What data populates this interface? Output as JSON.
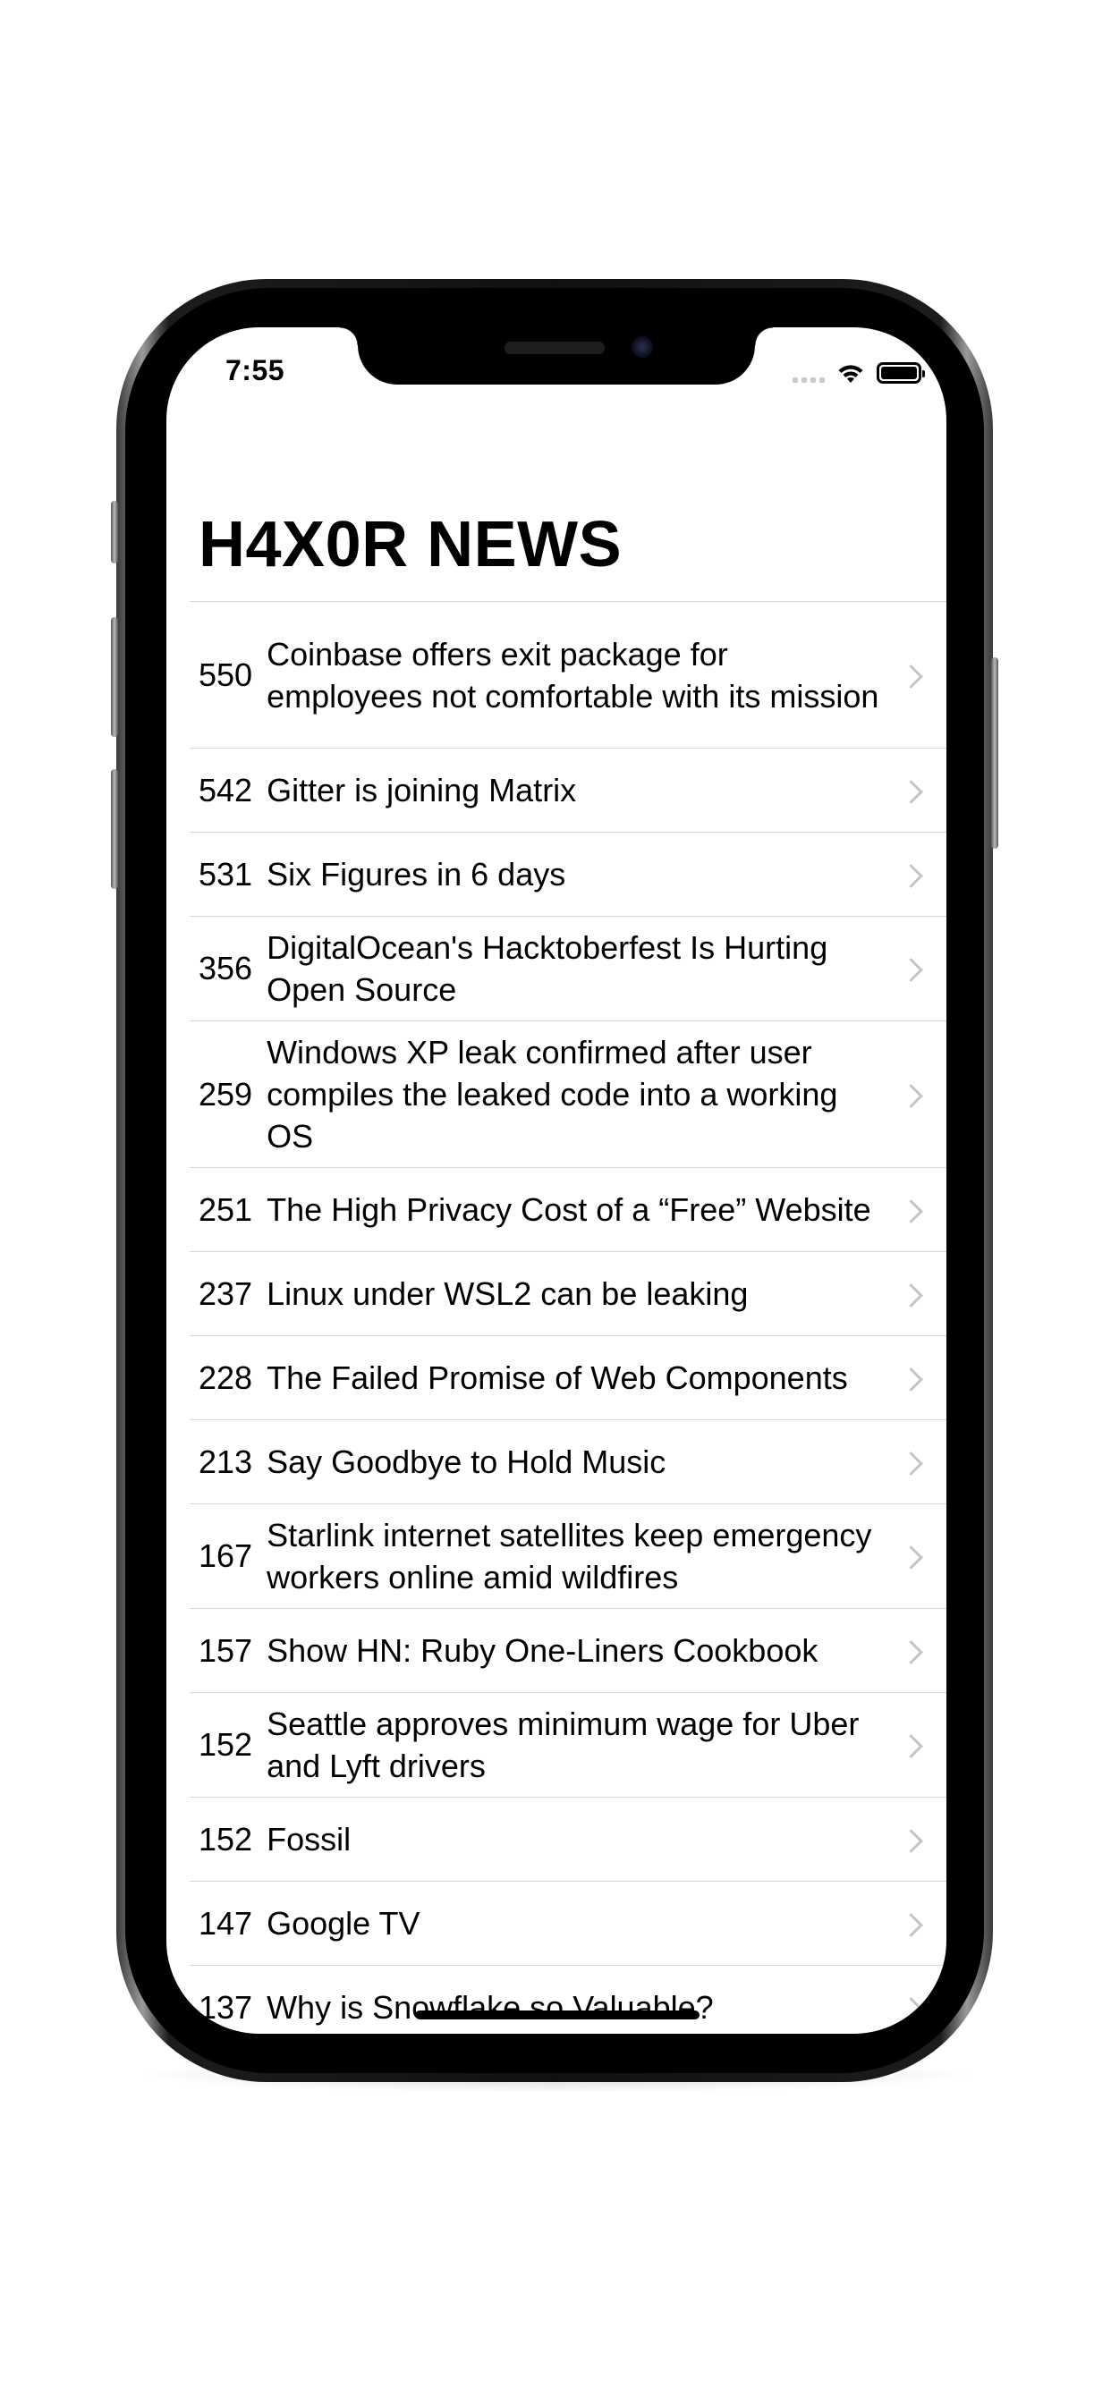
{
  "status_bar": {
    "time": "7:55"
  },
  "nav": {
    "title": "H4X0R NEWS"
  },
  "stories": [
    {
      "score": "550",
      "title": "Coinbase offers exit package for employees not comfortable with its mission"
    },
    {
      "score": "542",
      "title": "Gitter is joining Matrix"
    },
    {
      "score": "531",
      "title": "Six Figures in 6 days"
    },
    {
      "score": "356",
      "title": "DigitalOcean's Hacktoberfest Is Hurting Open Source"
    },
    {
      "score": "259",
      "title": "Windows XP leak confirmed after user compiles the leaked code into a working OS"
    },
    {
      "score": "251",
      "title": "The High Privacy Cost of a “Free” Website"
    },
    {
      "score": "237",
      "title": "Linux under WSL2 can be leaking"
    },
    {
      "score": "228",
      "title": "The Failed Promise of Web Components"
    },
    {
      "score": "213",
      "title": "Say Goodbye to Hold Music"
    },
    {
      "score": "167",
      "title": "Starlink internet satellites keep emergency workers online amid wildfires"
    },
    {
      "score": "157",
      "title": "Show HN: Ruby One-Liners Cookbook"
    },
    {
      "score": "152",
      "title": "Seattle approves minimum wage for Uber and Lyft drivers"
    },
    {
      "score": "152",
      "title": "Fossil"
    },
    {
      "score": "147",
      "title": "Google TV"
    },
    {
      "score": "137",
      "title": "Why is Snowflake so Valuable?"
    }
  ],
  "icons": {
    "chevron": "chevron-right-icon",
    "wifi": "wifi-icon",
    "battery": "battery-icon",
    "signal": "cellular-signal-icon"
  }
}
